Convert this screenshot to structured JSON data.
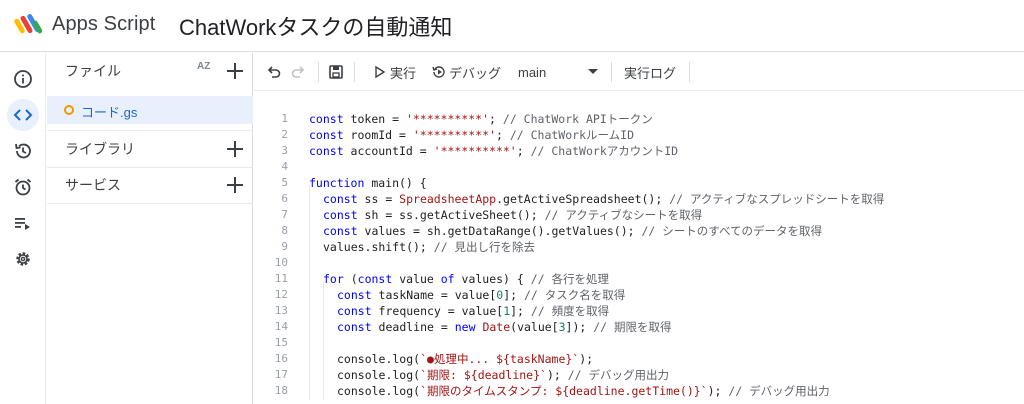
{
  "header": {
    "app_name": "Apps Script",
    "project_title": "ChatWorkタスクの自動通知"
  },
  "rail": {
    "items": [
      {
        "name": "overview",
        "icon": "info-icon"
      },
      {
        "name": "editor",
        "icon": "code-icon",
        "active": true
      },
      {
        "name": "versions",
        "icon": "history-icon"
      },
      {
        "name": "triggers",
        "icon": "alarm-icon"
      },
      {
        "name": "executions",
        "icon": "playlist-icon"
      },
      {
        "name": "settings",
        "icon": "gear-icon"
      }
    ]
  },
  "panel": {
    "files_label": "ファイル",
    "sort_label": "AZ",
    "file_name": "コード.gs",
    "libraries_label": "ライブラリ",
    "services_label": "サービス"
  },
  "toolbar": {
    "run_label": "実行",
    "debug_label": "デバッグ",
    "function_select": "main",
    "log_label": "実行ログ"
  },
  "editor": {
    "lines": [
      {
        "n": "1"
      },
      {
        "n": "2"
      },
      {
        "n": "3"
      },
      {
        "n": "4"
      },
      {
        "n": "5"
      },
      {
        "n": "6"
      },
      {
        "n": "7"
      },
      {
        "n": "8"
      },
      {
        "n": "9"
      },
      {
        "n": "10"
      },
      {
        "n": "11"
      },
      {
        "n": "12"
      },
      {
        "n": "13"
      },
      {
        "n": "14"
      },
      {
        "n": "15"
      },
      {
        "n": "16"
      },
      {
        "n": "17"
      },
      {
        "n": "18"
      }
    ],
    "code": {
      "l1_kw": "const",
      "l1_a": " token = ",
      "l1_str": "'**********'",
      "l1_b": "; ",
      "l1_cm": "// ChatWork APIトークン",
      "l2_kw": "const",
      "l2_a": " roomId = ",
      "l2_str": "'**********'",
      "l2_b": "; ",
      "l2_cm": "// ChatWorkルームID",
      "l3_kw": "const",
      "l3_a": " accountId = ",
      "l3_str": "'**********'",
      "l3_b": "; ",
      "l3_cm": "// ChatWorkアカウントID",
      "l5_kw": "function",
      "l5_a": " main() {",
      "l6_kw": "const",
      "l6_a": " ss = ",
      "l6_fn": "SpreadsheetApp",
      "l6_b": ".getActiveSpreadsheet(); ",
      "l6_cm": "// アクティブなスプレッドシートを取得",
      "l7_kw": "const",
      "l7_a": " sh = ss.getActiveSheet(); ",
      "l7_cm": "// アクティブなシートを取得",
      "l8_kw": "const",
      "l8_a": " values = sh.getDataRange().getValues(); ",
      "l8_cm": "// シートのすべてのデータを取得",
      "l9_a": "values.shift(); ",
      "l9_cm": "// 見出し行を除去",
      "l11_kw": "for",
      "l11_a": " (",
      "l11_kw2": "const",
      "l11_b": " value ",
      "l11_kw3": "of",
      "l11_c": " values) { ",
      "l11_cm": "// 各行を処理",
      "l12_kw": "const",
      "l12_a": " taskName = value[",
      "l12_num": "0",
      "l12_b": "]; ",
      "l12_cm": "// タスク名を取得",
      "l13_kw": "const",
      "l13_a": " frequency = value[",
      "l13_num": "1",
      "l13_b": "]; ",
      "l13_cm": "// 頻度を取得",
      "l14_kw": "const",
      "l14_a": " deadline = ",
      "l14_kw2": "new",
      "l14_b": " ",
      "l14_fn": "Date",
      "l14_c": "(value[",
      "l14_num": "3",
      "l14_d": "]); ",
      "l14_cm": "// 期限を取得",
      "l16_a": "console.log(",
      "l16_str": "`●処理中... ${taskName}`",
      "l16_b": ");",
      "l17_a": "console.log(",
      "l17_str": "`期限: ${deadline}`",
      "l17_b": "); ",
      "l17_cm": "// デバッグ用出力",
      "l18_a": "console.log(",
      "l18_str": "`期限のタイムスタンプ: ${deadline.getTime()}`",
      "l18_b": "); ",
      "l18_cm": "// デバッグ用出力"
    }
  },
  "colors": {
    "accent": "#1967d2",
    "active_bg": "#e8f0fe",
    "file_dot": "#f29900"
  }
}
